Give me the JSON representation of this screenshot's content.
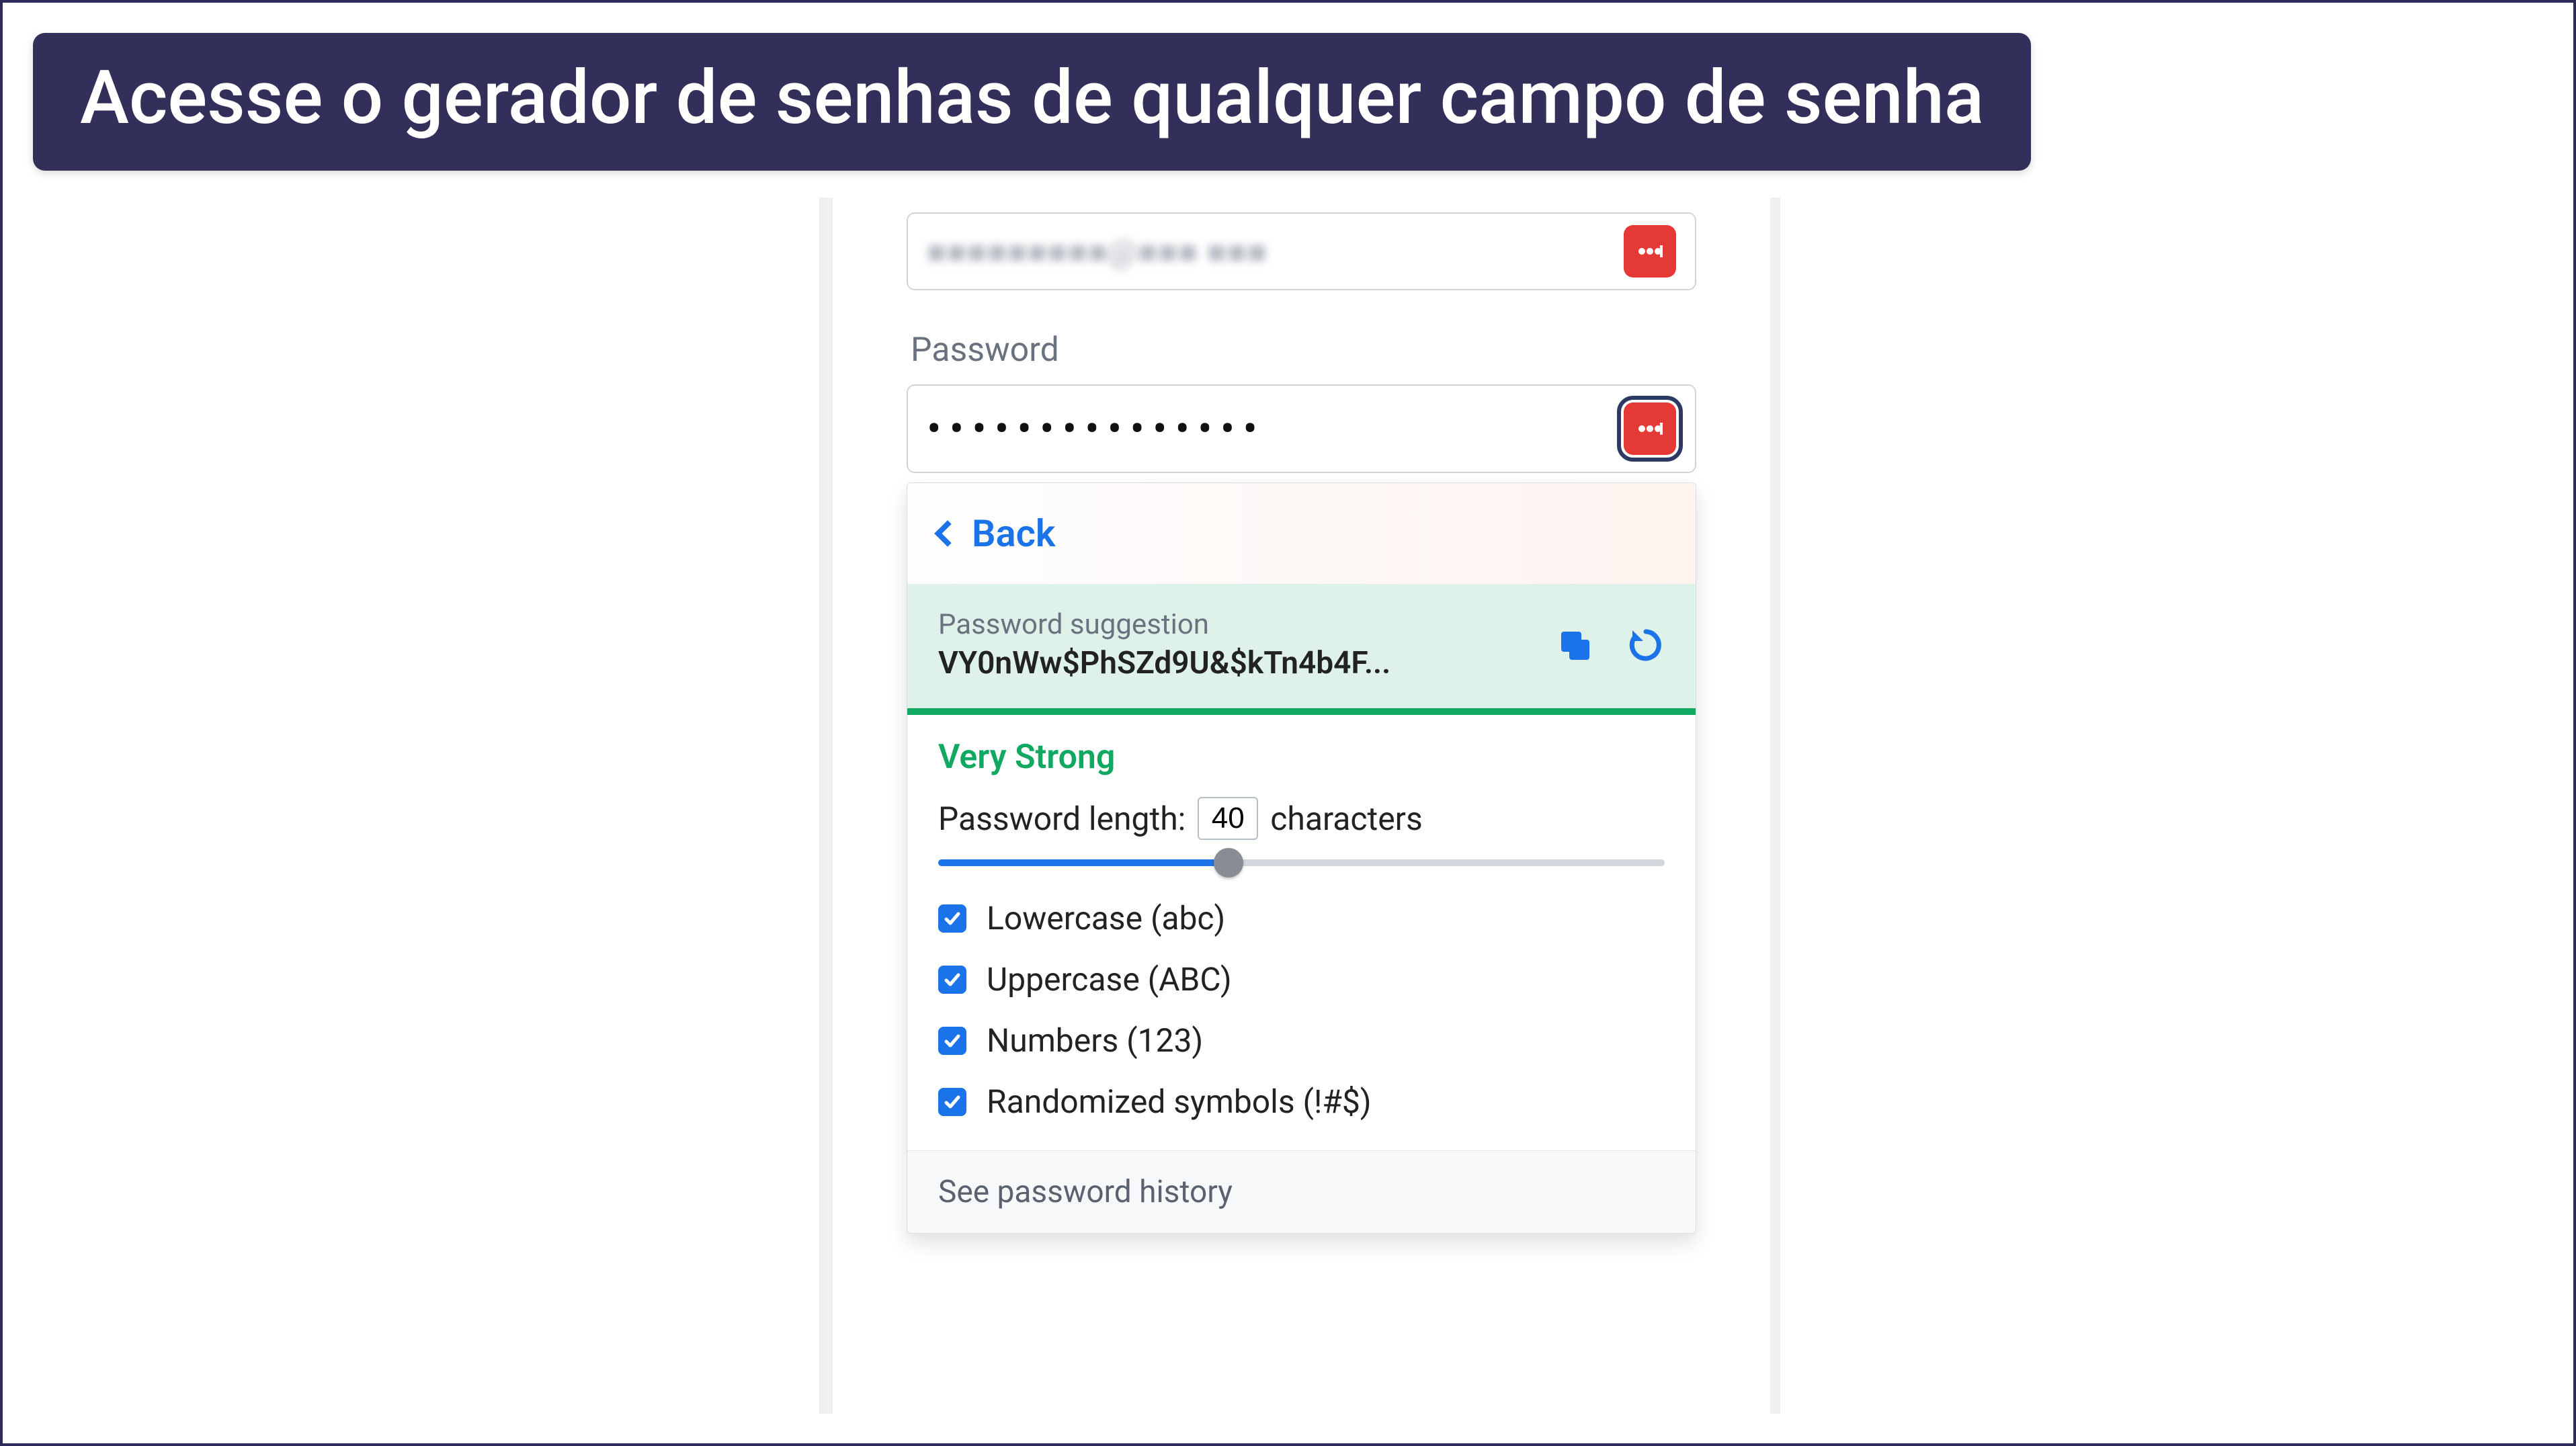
{
  "banner": {
    "title": "Acesse o gerador de senhas de qualquer campo de senha"
  },
  "fields": {
    "email_blurred": "■■■■■■■■■@■■■ ■■■",
    "password_label": "Password",
    "password_value": "•••••••••••••••"
  },
  "popup": {
    "back_label": "Back",
    "suggestion_label": "Password suggestion",
    "suggestion_value": "VY0nWw$PhSZd9U&$kTn4b4F...",
    "strength_label": "Very Strong",
    "length_label_before": "Password length:",
    "length_value": "40",
    "length_label_after": "characters",
    "slider_percent": 40,
    "options": [
      {
        "label": "Lowercase (abc)",
        "checked": true
      },
      {
        "label": "Uppercase (ABC)",
        "checked": true
      },
      {
        "label": "Numbers (123)",
        "checked": true
      },
      {
        "label": "Randomized symbols (!#$)",
        "checked": true
      }
    ],
    "history_label": "See password history"
  },
  "icons": {
    "pm": "password-manager-icon",
    "copy": "copy-icon",
    "refresh": "refresh-icon",
    "chevron_left": "chevron-left-icon",
    "check": "check-icon"
  }
}
